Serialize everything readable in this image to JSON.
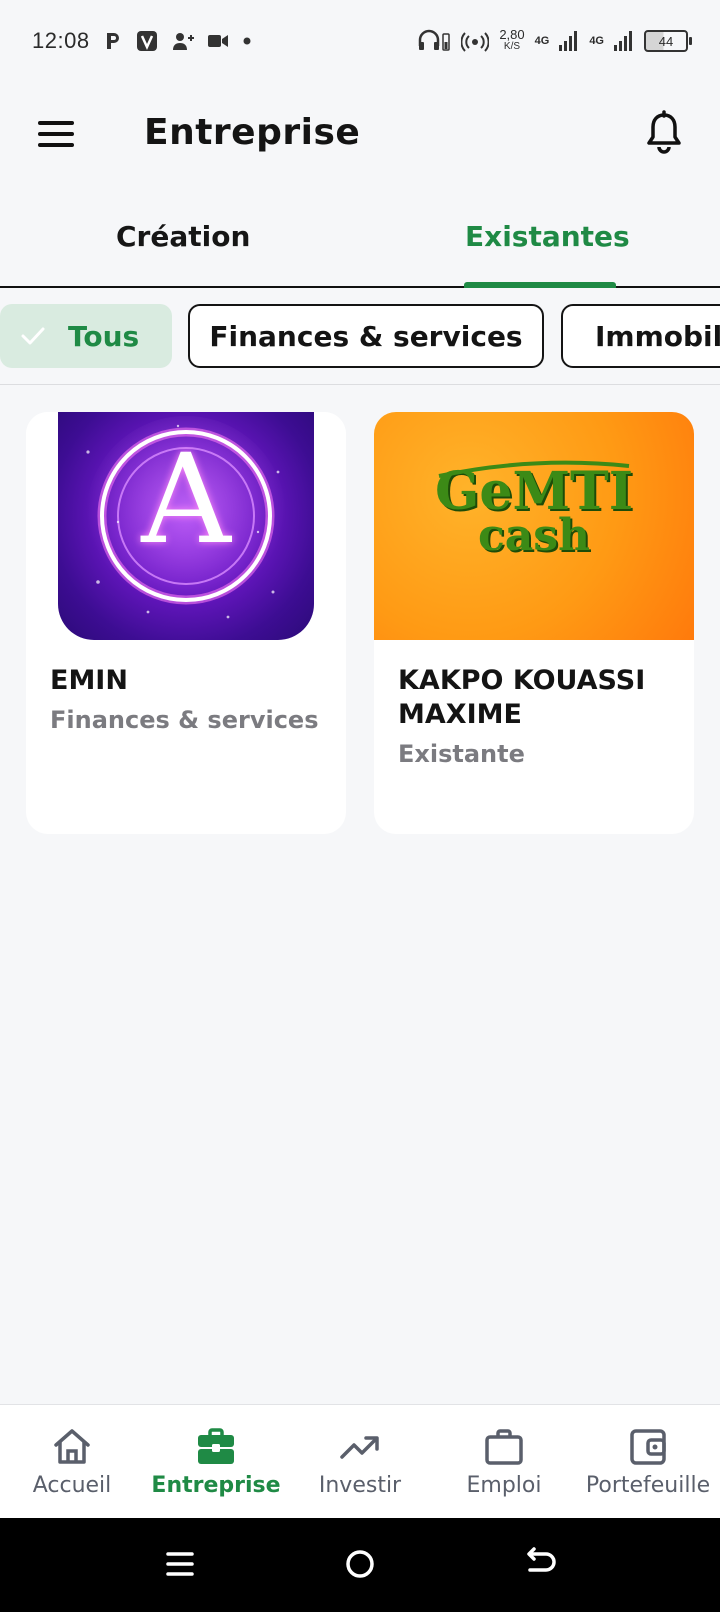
{
  "status_bar": {
    "time": "12:08",
    "speed_value": "2,80",
    "speed_unit": "K/S",
    "network_1": "4G",
    "network_2": "4G",
    "battery": "44",
    "icons": [
      "parking-icon",
      "v-app-icon",
      "add-contact-icon",
      "video-icon",
      "dot-icon",
      "headset-icon",
      "hotspot-icon",
      "signal-icon",
      "battery-icon"
    ]
  },
  "header": {
    "title": "Entreprise",
    "menu_icon": "hamburger-menu-icon",
    "bell_icon": "bell-icon"
  },
  "tabs": [
    {
      "label": "Création",
      "active": false
    },
    {
      "label": "Existantes",
      "active": true
    }
  ],
  "filters": [
    {
      "label": "Tous",
      "selected": true
    },
    {
      "label": "Finances & services",
      "selected": false
    },
    {
      "label": "Immobili",
      "selected": false
    }
  ],
  "cards": [
    {
      "title": "EMIN",
      "subtitle": "Finances & services",
      "logo_letter": "A"
    },
    {
      "title": "KAKPO KOUASSI MAXIME",
      "subtitle": "Existante",
      "logo_text_1": "GeMTI",
      "logo_text_2": "cash"
    }
  ],
  "bottom_nav": [
    {
      "label": "Accueil",
      "icon": "home-icon",
      "active": false
    },
    {
      "label": "Entreprise",
      "icon": "briefcase-icon",
      "active": true
    },
    {
      "label": "Investir",
      "icon": "trending-up-icon",
      "active": false
    },
    {
      "label": "Emploi",
      "icon": "bag-icon",
      "active": false
    },
    {
      "label": "Portefeuille",
      "icon": "wallet-icon",
      "active": false
    }
  ],
  "colors": {
    "accent": "#1f8a45",
    "chip_selected_bg": "#d9ebe0",
    "background": "#f6f7f9",
    "muted_text": "#7b7b80"
  }
}
